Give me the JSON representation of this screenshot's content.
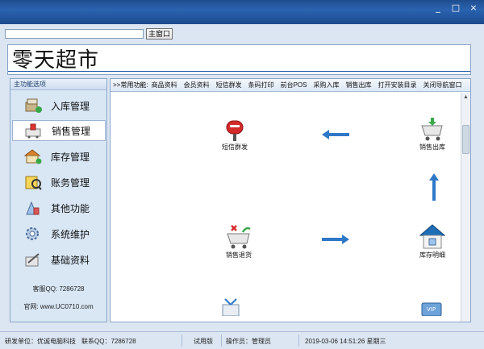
{
  "window": {
    "buttons": {
      "minimize": "_",
      "maximize": "□",
      "close": "×"
    }
  },
  "toolbar": {
    "address_value": "",
    "main_window_label": "主窗口"
  },
  "banner": {
    "title": "零天超市"
  },
  "sidebar": {
    "header": "主功能选项",
    "items": [
      {
        "label": "入库管理",
        "icon": "stock-in-icon"
      },
      {
        "label": "销售管理",
        "icon": "sales-icon",
        "selected": true
      },
      {
        "label": "库存管理",
        "icon": "warehouse-icon"
      },
      {
        "label": "账务管理",
        "icon": "accounting-icon"
      },
      {
        "label": "其他功能",
        "icon": "other-icon"
      },
      {
        "label": "系统维护",
        "icon": "system-icon"
      },
      {
        "label": "基础资料",
        "icon": "basic-data-icon"
      }
    ],
    "service_qq": "客服QQ: 7286728",
    "website": "官网: www.UC0710.com"
  },
  "quick_bar": {
    "lead": ">>常用功能:",
    "links": [
      "商品资料",
      "会员资料",
      "短信群发",
      "条码打印",
      "前台POS",
      "采购入库",
      "销售出库",
      "打开安装目录",
      "关闭导航窗口"
    ]
  },
  "flow": {
    "sms": "短信群发",
    "sales_out": "销售出库",
    "sales_return": "销售退货",
    "stock_detail": "库存明细"
  },
  "status": {
    "developer": "研发单位：优诚电脑科技",
    "contact": "联系QQ：7286728",
    "edition": "试用版",
    "operator": "操作员：管理员",
    "datetime": "2019-03-06  14:51:26 星期三"
  },
  "colors": {
    "titlebar": "#1e4d8f",
    "accent": "#1e5aa8",
    "arrow": "#2f78c8"
  }
}
